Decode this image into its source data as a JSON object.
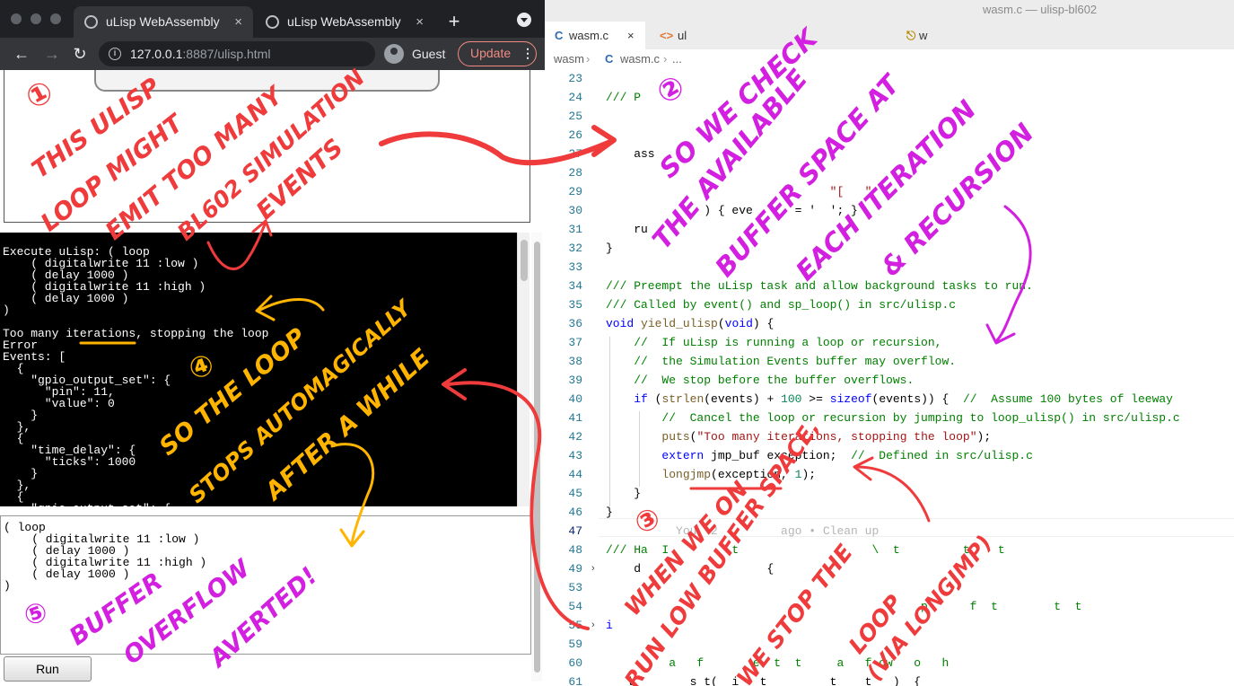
{
  "browser": {
    "tabs": [
      {
        "title": "uLisp WebAssembly",
        "close": "×"
      },
      {
        "title": "uLisp WebAssembly",
        "close": "×"
      }
    ],
    "new_tab": "+",
    "nav": {
      "back": "←",
      "forward": "→",
      "reload": "↻"
    },
    "url_host": "127.0.0.1",
    "url_rest": ":8887/ulisp.html",
    "profile": "Guest",
    "update": "Update",
    "update_menu": "⋮"
  },
  "page": {
    "console_text": "Execute uLisp: ( loop\n    ( digitalwrite 11 :low )\n    ( delay 1000 )\n    ( digitalwrite 11 :high )\n    ( delay 1000 )\n)\n\nToo many iterations, stopping the loop\nError\nEvents: [\n  {\n    \"gpio_output_set\": {\n      \"pin\": 11,\n      \"value\": 0\n    }\n  },\n  {\n    \"time_delay\": {\n      \"ticks\": 1000\n    }\n  },\n  {\n    \"gpio_output_set\": {",
    "editor_text": "( loop\n    ( digitalwrite 11 :low )\n    ( delay 1000 )\n    ( digitalwrite 11 :high )\n    ( delay 1000 )\n)",
    "run_button": "Run"
  },
  "vscode": {
    "window_title": "wasm.c — ulisp-bl602",
    "tabs": [
      {
        "icon": "C",
        "label": "wasm.c",
        "close": "×"
      },
      {
        "icon": "<>",
        "label": "ul"
      },
      {
        "icon": "⎋",
        "label": "w"
      }
    ],
    "breadcrumb": [
      "wasm",
      "C",
      "wasm.c",
      "..."
    ],
    "lines": [
      {
        "n": "23",
        "text": ""
      },
      {
        "n": "24",
        "text": "/// P"
      },
      {
        "n": "25",
        "text": ""
      },
      {
        "n": "26",
        "text": ""
      },
      {
        "n": "27",
        "text": "    ass"
      },
      {
        "n": "28",
        "text": ""
      },
      {
        "n": "29",
        "text": "                                \"[   \""
      },
      {
        "n": "30",
        "text": "              ) { eve      = '  '; }"
      },
      {
        "n": "31",
        "text": "    ru"
      },
      {
        "n": "32",
        "text": "}"
      },
      {
        "n": "33",
        "text": ""
      },
      {
        "n": "34",
        "text": "/// Preempt the uLisp task and allow background tasks to run."
      },
      {
        "n": "35",
        "text": "/// Called by event() and sp_loop() in src/ulisp.c"
      },
      {
        "n": "36",
        "text": "void yield_ulisp(void) {"
      },
      {
        "n": "37",
        "text": "    //  If uLisp is running a loop or recursion,"
      },
      {
        "n": "38",
        "text": "    //  the Simulation Events buffer may overflow."
      },
      {
        "n": "39",
        "text": "    //  We stop before the buffer overflows."
      },
      {
        "n": "40",
        "text": "    if (strlen(events) + 100 >= sizeof(events)) {  //  Assume 100 bytes of leeway"
      },
      {
        "n": "41",
        "text": "        //  Cancel the loop or recursion by jumping to loop_ulisp() in src/ulisp.c"
      },
      {
        "n": "42",
        "text": "        puts(\"Too many iterations, stopping the loop\");"
      },
      {
        "n": "43",
        "text": "        extern jmp_buf exception;  //  Defined in src/ulisp.c"
      },
      {
        "n": "44",
        "text": "        longjmp(exception, 1);"
      },
      {
        "n": "45",
        "text": "    }"
      },
      {
        "n": "46",
        "text": "}"
      },
      {
        "n": "47",
        "text": "          You, 2         ago • Clean up"
      },
      {
        "n": "48",
        "text": "/// Ha  I         t                   \\  t         t    t"
      },
      {
        "n": "49",
        "text": "    d                  {"
      },
      {
        "n": "53",
        "text": ""
      },
      {
        "n": "54",
        "text": "                                             p      f  t        t  t"
      },
      {
        "n": "55",
        "text": "i   "
      },
      {
        "n": "59",
        "text": ""
      },
      {
        "n": "60",
        "text": "         a   f       e  t  t     a   f ow   o   h"
      },
      {
        "n": "61",
        "text": "   l        s t(  i   t        _t    t   )  {"
      }
    ]
  },
  "annotations": {
    "n1": "①",
    "n2": "②",
    "n3": "③",
    "n4": "④",
    "n5": "⑤",
    "note1": [
      "THIS ULISP",
      "LOOP MIGHT",
      "EMIT TOO MANY",
      "BL602 SIMULATION",
      "EVENTS"
    ],
    "note2": [
      "SO WE CHECK",
      "THE AVAILABLE",
      "BUFFER SPACE AT",
      "EACH ITERATION",
      "& RECURSION"
    ],
    "note3": [
      "WHEN WE ON",
      "RUN LOW BUFFER SPACE,",
      "WE STOP THE",
      "LOOP",
      "(VIA LONGJMP)"
    ],
    "note4": [
      "SO THE LOOP",
      "STOPS AUTOMAGICALLY",
      "AFTER A WHILE"
    ],
    "note5": [
      "BUFFER",
      "OVERFLOW",
      "AVERTED!"
    ],
    "colors": {
      "red": "#ef3b3b",
      "magenta": "#d21fe0",
      "orange": "#ffb400"
    }
  }
}
